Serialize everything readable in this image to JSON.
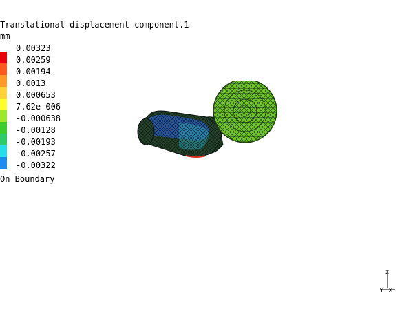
{
  "plot": {
    "title": "Translational displacement component.1",
    "unit": "mm",
    "boundary_note": "On Boundary"
  },
  "legend": {
    "entries": [
      {
        "value": "0.00323",
        "color": "#e8000b"
      },
      {
        "value": "0.00259",
        "color": "#ff5a1f"
      },
      {
        "value": "0.00194",
        "color": "#ff9a29"
      },
      {
        "value": "0.0013",
        "color": "#ffd23a"
      },
      {
        "value": "0.000653",
        "color": "#ffff2e"
      },
      {
        "value": "7.62e-006",
        "color": "#9ee82c"
      },
      {
        "value": "-0.000638",
        "color": "#3ccc2e"
      },
      {
        "value": "-0.00128",
        "color": "#2ecc68"
      },
      {
        "value": "-0.00193",
        "color": "#25dfe6"
      },
      {
        "value": "-0.00257",
        "color": "#1c8cf0"
      },
      {
        "value": "-0.00322",
        "color": "#0019d6"
      }
    ]
  },
  "axes": {
    "z_label": "Z",
    "y_label": "Y",
    "x_label": "X"
  },
  "colors": {
    "mesh_green": "#6fc62a",
    "mesh_dark": "#1e3b10",
    "mesh_blue": "#1c3ea8",
    "mesh_cyan": "#2aa6b8"
  }
}
